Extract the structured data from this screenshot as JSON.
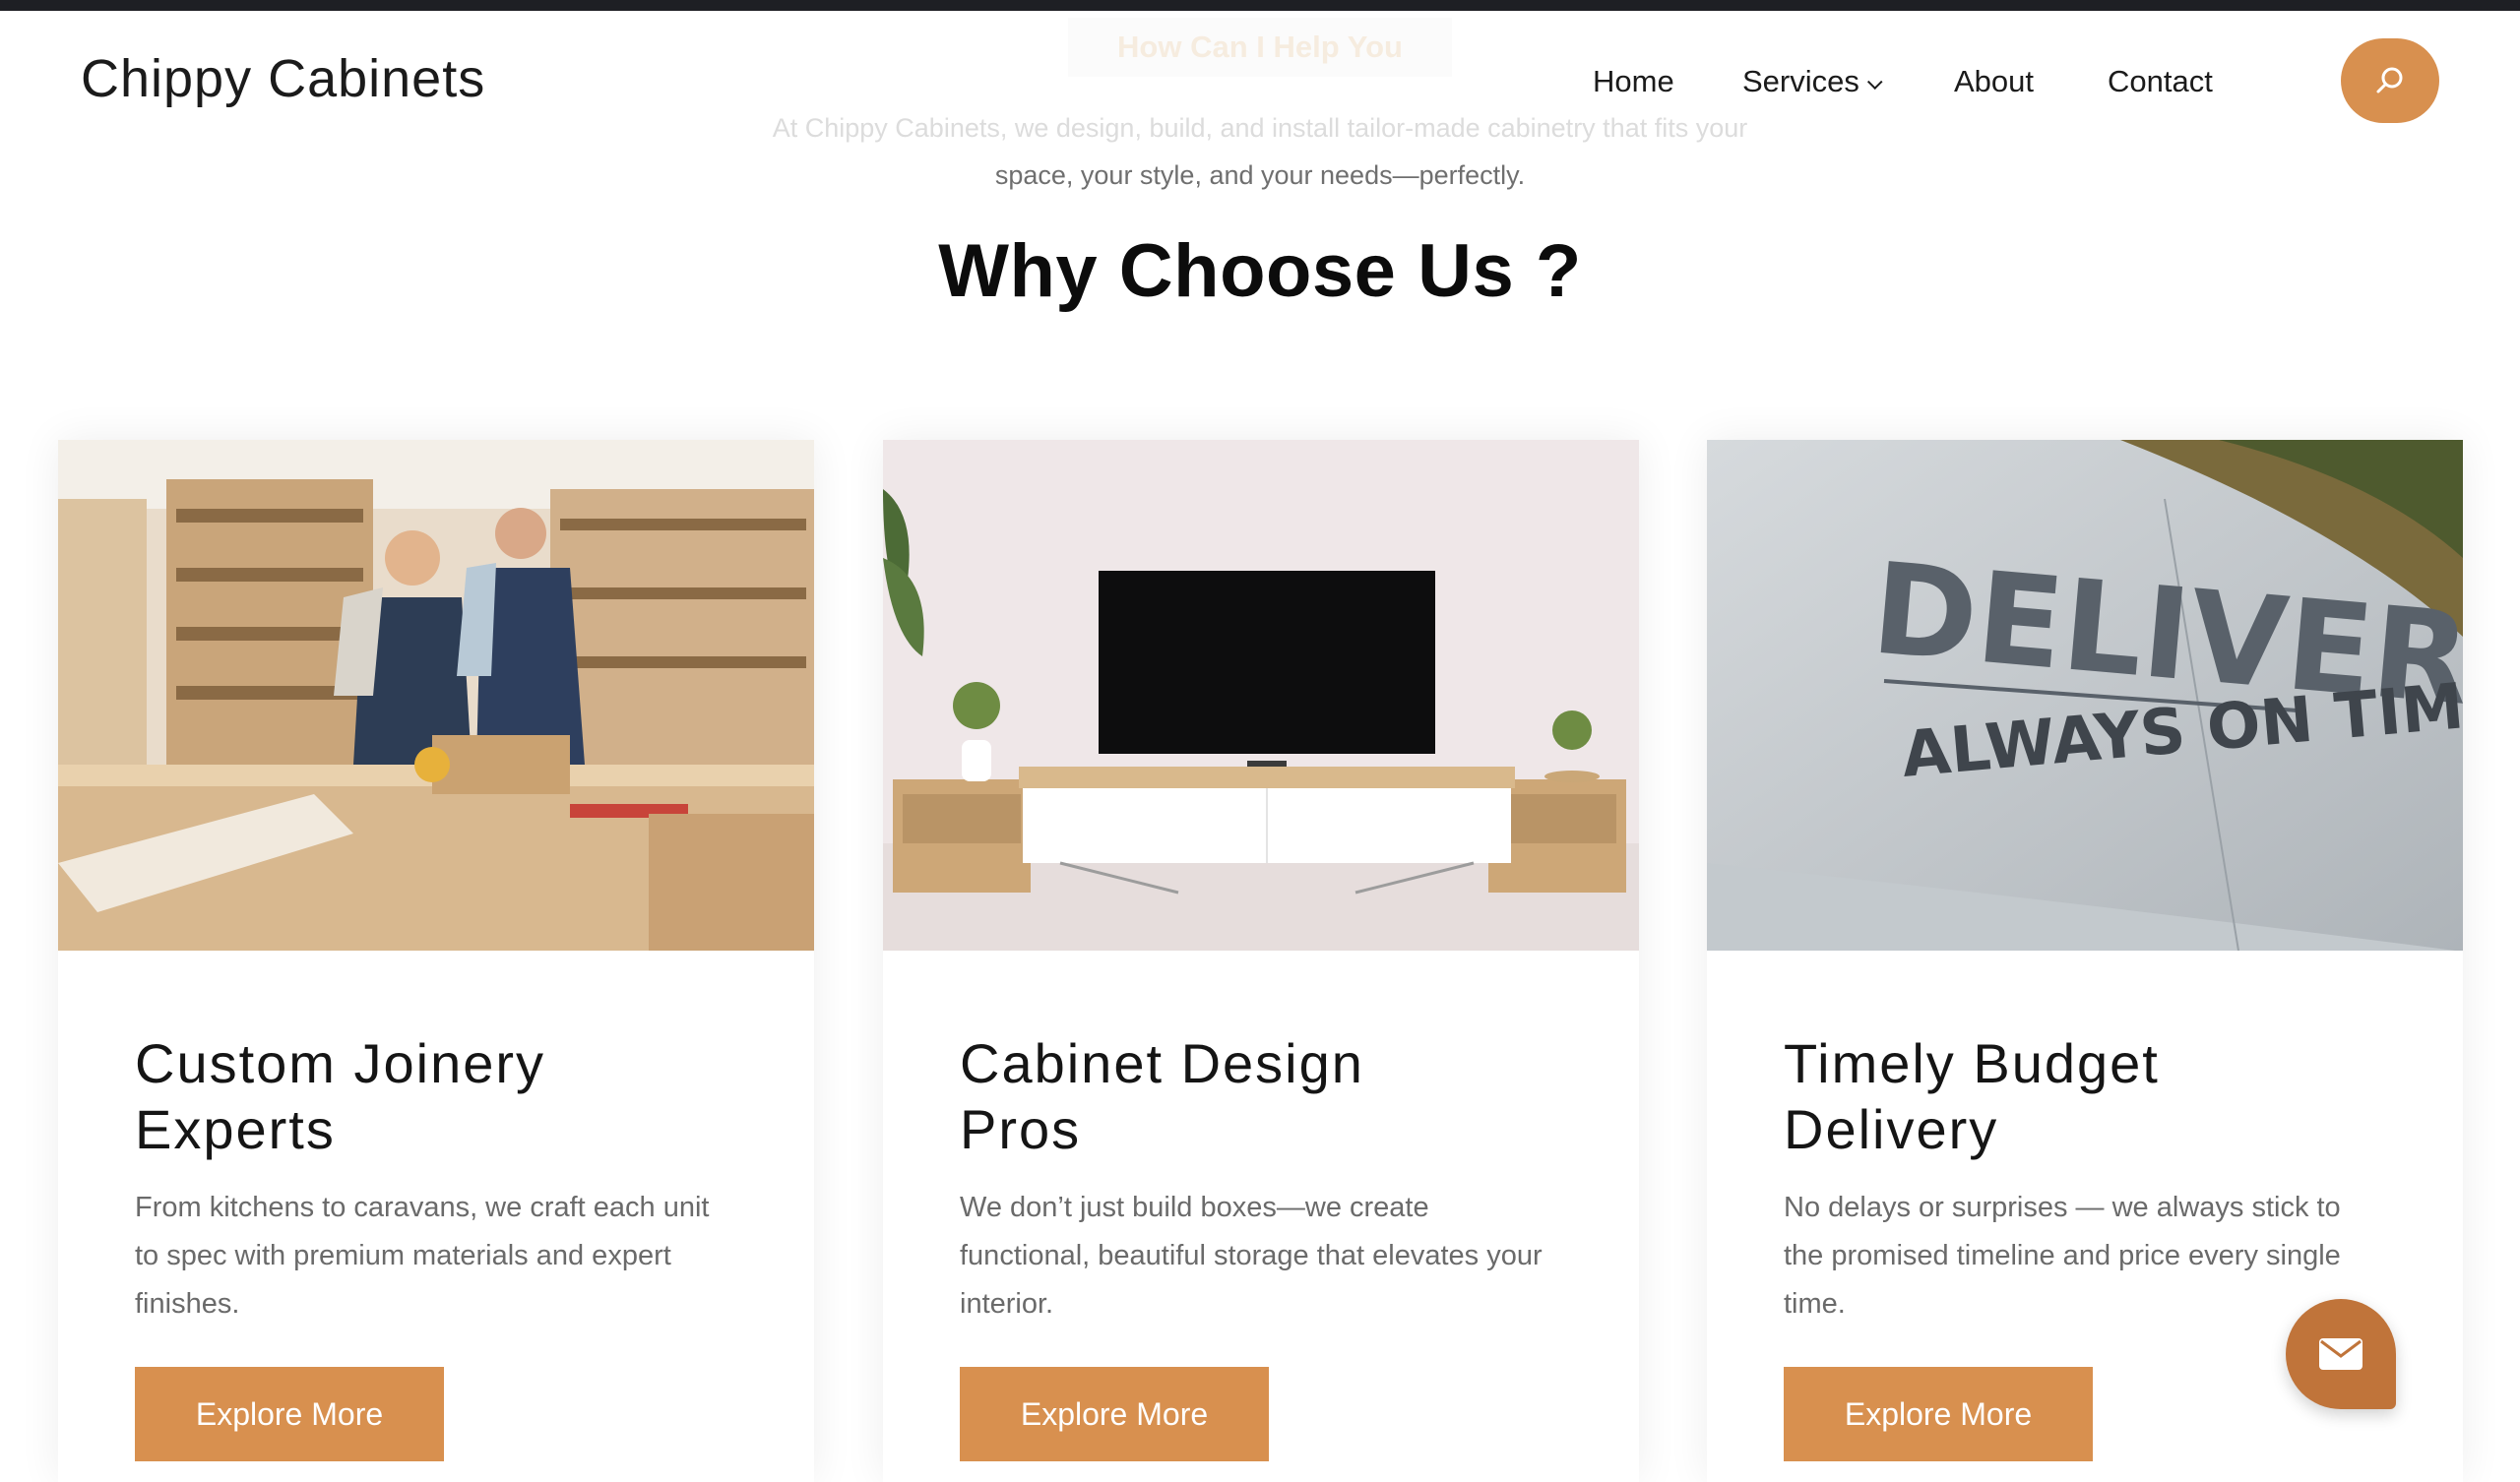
{
  "intro": {
    "eyebrow": "How Can I Help You",
    "line1": "At Chippy Cabinets, we design, build, and install tailor-made cabinetry that fits your",
    "line2": "space, your style, and your needs—perfectly."
  },
  "header": {
    "brand": "Chippy Cabinets",
    "nav": [
      {
        "label": "Home"
      },
      {
        "label": "Services"
      },
      {
        "label": "About"
      },
      {
        "label": "Contact"
      }
    ],
    "search_icon": "search-icon"
  },
  "section": {
    "title": "Why Choose Us ?"
  },
  "cards": [
    {
      "title_line1": "Custom Joinery",
      "title_line2": "Experts",
      "body": "From kitchens to caravans, we craft each unit to spec with premium materials and expert finishes.",
      "button": "Explore More",
      "image": "workshop-photo"
    },
    {
      "title_line1": "Cabinet Design",
      "title_line2": "Pros",
      "body": "We don’t just build boxes—we create functional, beautiful storage that elevates your interior.",
      "button": "Explore More",
      "image": "tv-cabinet-photo"
    },
    {
      "title_line1": "Timely Budget",
      "title_line2": "Delivery",
      "body": "No delays or surprises — we always stick to the promised timeline and price every single time.",
      "button": "Explore More",
      "image": "delivery-van-photo",
      "image_text_1": "DELIVERY",
      "image_text_2": "ALWAYS ON TIME"
    }
  ],
  "floating": {
    "mail_icon": "mail-icon"
  },
  "colors": {
    "accent": "#d8904f",
    "accent_dark": "#c0743a",
    "topbar": "#1e1f24",
    "heading": "#0c0c0c",
    "body_text": "#6a6a6a"
  }
}
